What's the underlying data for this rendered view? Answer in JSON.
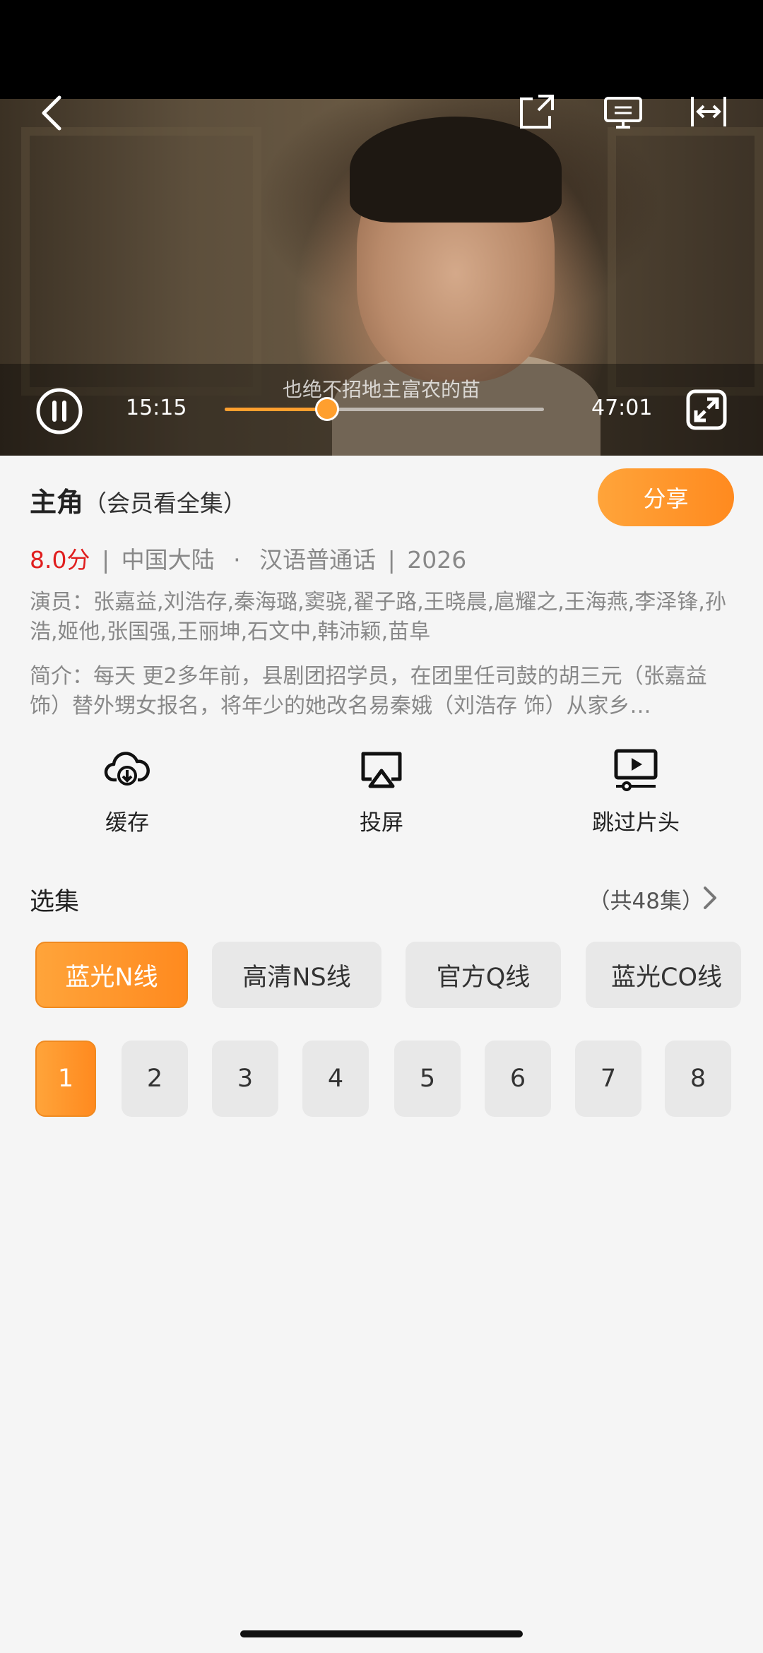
{
  "player": {
    "subtitle": "也绝不招地主富农的苗",
    "current_time": "15:15",
    "total_time": "47:01",
    "progress": 0.32,
    "accent": "#ff9f2e"
  },
  "show": {
    "title": "主角",
    "title_note": "（会员看全集）",
    "share_label": "分享",
    "score": "8.0分",
    "region": "中国大陆",
    "dot": "·",
    "language": "汉语普通话",
    "year": "2026",
    "divider": "|",
    "cast": "演员：张嘉益,刘浩存,秦海璐,窦骁,翟子路,王晓晨,扈耀之,王海燕,李泽锋,孙浩,姬他,张国强,王丽坤,石文中,韩沛颖,苗阜",
    "description": "简介：每天 更2多年前，县剧团招学员，在团里任司鼓的胡三元（张嘉益 饰）替外甥女报名，将年少的她改名易秦娥（刘浩存 饰）从家乡…"
  },
  "actions": [
    {
      "label": "缓存",
      "icon": "download-cloud-icon"
    },
    {
      "label": "投屏",
      "icon": "airplay-icon"
    },
    {
      "label": "跳过片头",
      "icon": "skip-intro-icon"
    }
  ],
  "episodes": {
    "section_title": "选集",
    "count_label": "（共48集）",
    "lines": [
      "蓝光N线",
      "高清NS线",
      "官方Q线",
      "蓝光CO线"
    ],
    "numbers": [
      "1",
      "2",
      "3",
      "4",
      "5",
      "6",
      "7",
      "8"
    ]
  }
}
